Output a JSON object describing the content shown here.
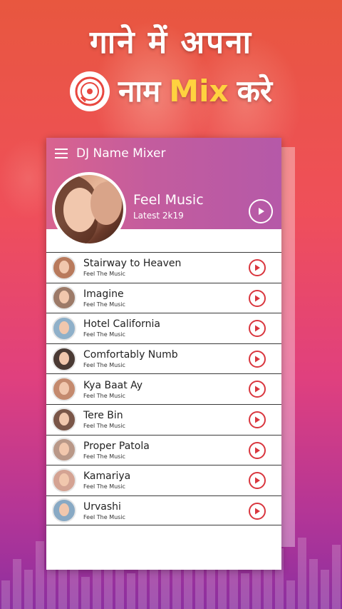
{
  "promo": {
    "line1": "गाने में अपना",
    "line2_pre": "नाम",
    "line2_mix": "Mix",
    "line2_post": "करे"
  },
  "app": {
    "title": "DJ Name Mixer"
  },
  "featured": {
    "name": "Feel Music",
    "subtitle": "Latest 2k19"
  },
  "songs": [
    {
      "title": "Stairway to Heaven",
      "artist": "Feel The Music",
      "thumb_color": "#b87a5c"
    },
    {
      "title": "Imagine",
      "artist": "Feel The Music",
      "thumb_color": "#9c7a68"
    },
    {
      "title": "Hotel California",
      "artist": "Feel The Music",
      "thumb_color": "#8fb0c9"
    },
    {
      "title": "Comfortably Numb",
      "artist": "Feel The Music",
      "thumb_color": "#4a3a34"
    },
    {
      "title": "Kya Baat Ay",
      "artist": "Feel The Music",
      "thumb_color": "#c48a6e"
    },
    {
      "title": "Tere Bin",
      "artist": "Feel The Music",
      "thumb_color": "#7a5648"
    },
    {
      "title": "Proper Patola",
      "artist": "Feel The Music",
      "thumb_color": "#b99888"
    },
    {
      "title": "Kamariya",
      "artist": "Feel The Music",
      "thumb_color": "#d4a393"
    },
    {
      "title": "Urvashi",
      "artist": "Feel The Music",
      "thumb_color": "#88a9c4"
    }
  ],
  "colors": {
    "accent": "#d9363e",
    "mix_yellow": "#ffd23f",
    "header_pink": "#c35c9e"
  }
}
